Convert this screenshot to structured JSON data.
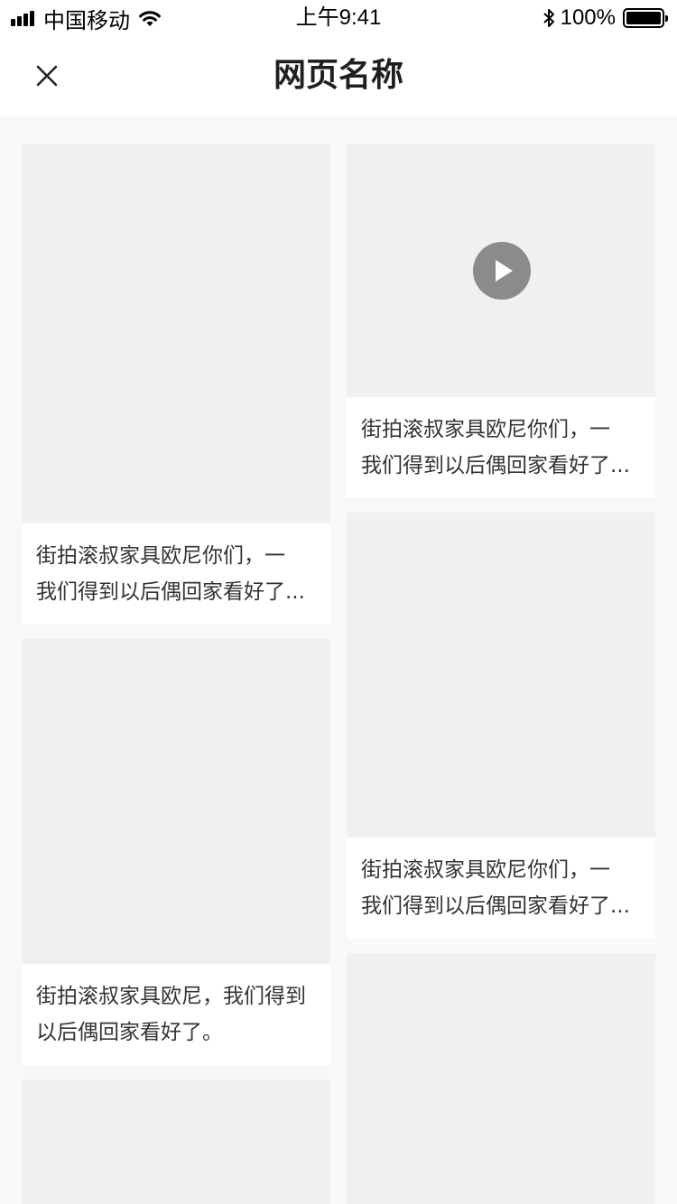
{
  "status_bar": {
    "carrier": "中国移动",
    "time": "上午9:41",
    "battery": "100%",
    "icons": [
      "signal-bars-icon",
      "wifi-icon",
      "bluetooth-icon",
      "battery-icon"
    ]
  },
  "navbar": {
    "title": "网页名称",
    "close_icon": "close-icon"
  },
  "feed": {
    "cards": [
      {
        "has_video": false,
        "caption": [
          "街拍滚叔家具欧尼你们，一",
          "我们得到以后偶回家看好了..."
        ]
      },
      {
        "has_video": true,
        "caption": [
          "街拍滚叔家具欧尼你们，一",
          "我们得到以后偶回家看好了..."
        ]
      },
      {
        "has_video": false,
        "caption": [
          "街拍滚叔家具欧尼，我们得到",
          "以后偶回家看好了。"
        ]
      },
      {
        "has_video": false,
        "caption": [
          "街拍滚叔家具欧尼你们，一",
          "我们得到以后偶回家看好了..."
        ]
      },
      {
        "has_video": false,
        "caption": []
      },
      {
        "has_video": false,
        "caption": []
      }
    ]
  },
  "colors": {
    "page_background": "#f8f8f8",
    "card_background": "#ffffff",
    "image_placeholder": "#f0f0f0",
    "text": "#333333",
    "title": "#1f1f1f"
  }
}
